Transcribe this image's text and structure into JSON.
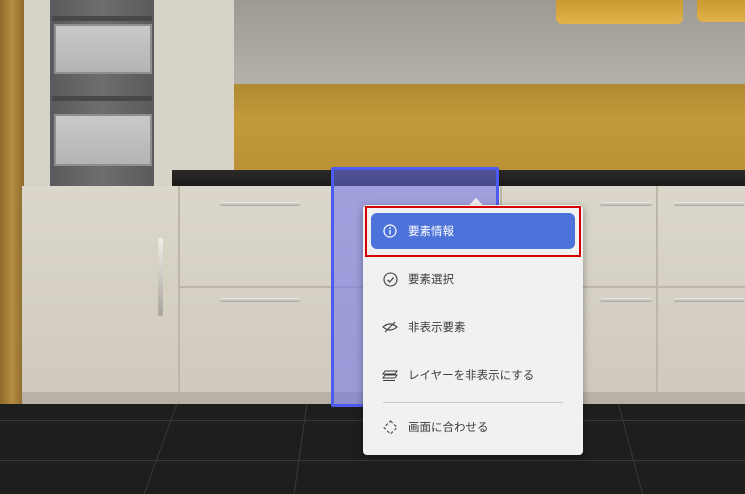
{
  "menu": {
    "items": [
      {
        "label": "要素情報",
        "icon": "info-icon",
        "active": true
      },
      {
        "label": "要素選択",
        "icon": "check-circle-icon",
        "active": false
      },
      {
        "label": "非表示要素",
        "icon": "eye-off-icon",
        "active": false
      },
      {
        "label": "レイヤーを非表示にする",
        "icon": "layers-icon",
        "active": false
      },
      {
        "label": "画面に合わせる",
        "icon": "fit-screen-icon",
        "active": false
      }
    ]
  },
  "colors": {
    "active_item": "#4d72d9",
    "selection": "#4d5cf0",
    "focus_ring": "#d40000"
  }
}
